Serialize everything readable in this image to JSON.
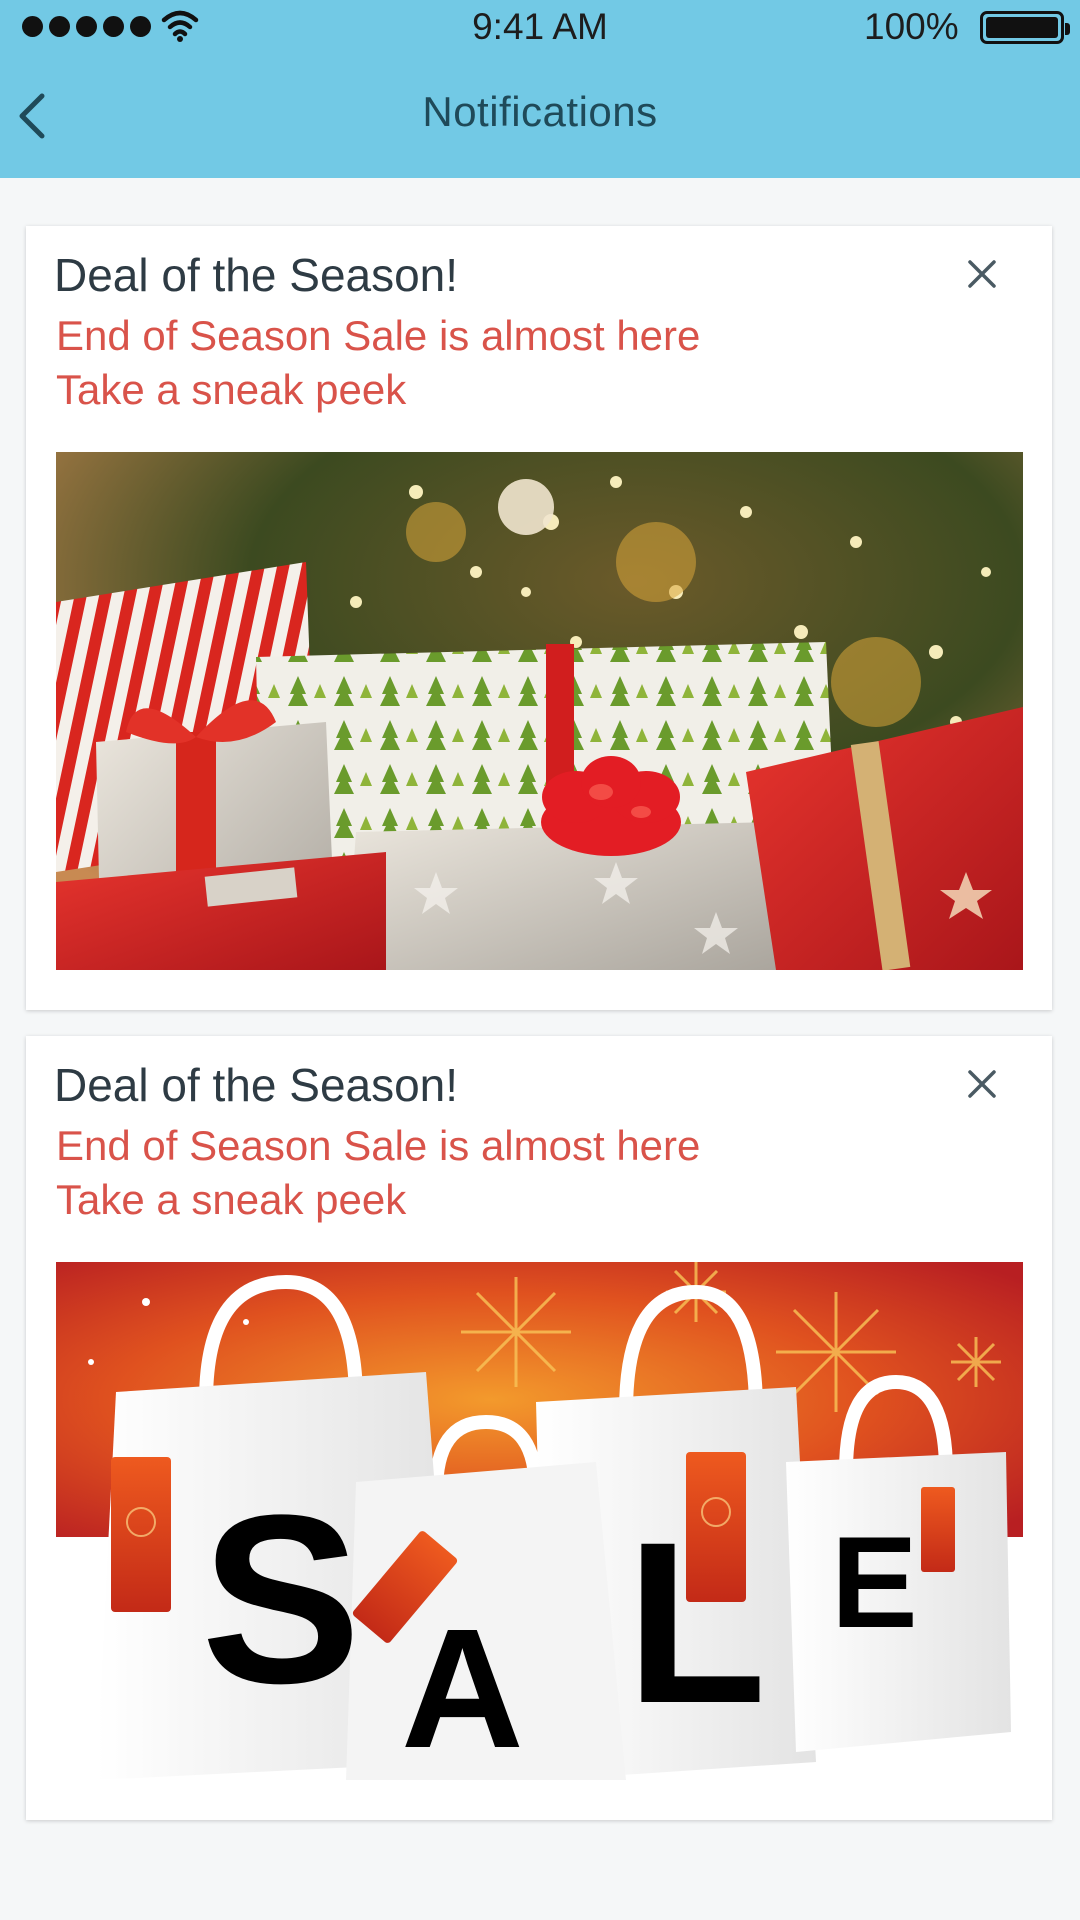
{
  "status_bar": {
    "time": "9:41 AM",
    "battery": "100%",
    "icons": [
      "signal-dots-icon",
      "wifi-icon",
      "battery-icon"
    ]
  },
  "header": {
    "title": "Notifications",
    "back_icon": "chevron-left-icon",
    "background": "#72c9e5"
  },
  "notifications": [
    {
      "title": "Deal of the Season!",
      "line1": "End of Season Sale is almost here",
      "line2": "Take a sneak peek",
      "image": "christmas-presents-image",
      "dismiss_icon": "close-icon"
    },
    {
      "title": "Deal of the Season!",
      "line1": "End of Season Sale is almost here",
      "line2": "Take a sneak peek",
      "image": "sale-shopping-bags-image",
      "image_text": "SALE",
      "dismiss_icon": "close-icon"
    }
  ],
  "colors": {
    "title_text": "#2e3b44",
    "subtitle_text": "#d9534a",
    "nav_title": "#1f4a59"
  }
}
